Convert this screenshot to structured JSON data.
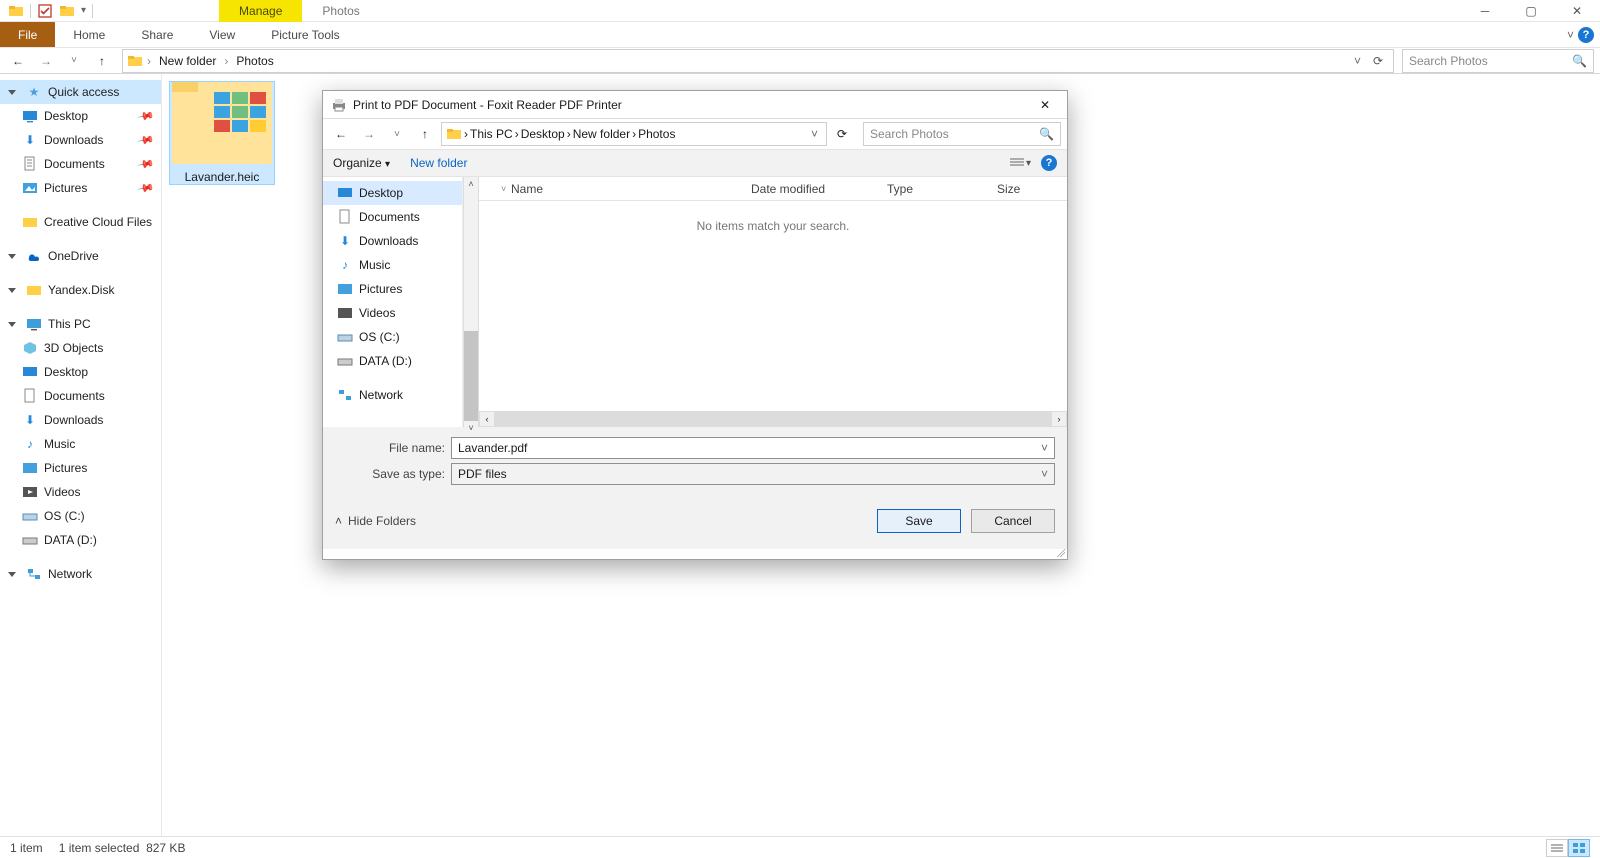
{
  "titlebar": {
    "tab_manage": "Manage",
    "tab_photos": "Photos"
  },
  "ribbon": {
    "file": "File",
    "home": "Home",
    "share": "Share",
    "view": "View",
    "picture_tools": "Picture Tools"
  },
  "nav": {
    "crumbs": [
      "New folder",
      "Photos"
    ],
    "search_placeholder": "Search Photos"
  },
  "sidebar": {
    "quick_access": "Quick access",
    "items_pinned": [
      {
        "label": "Desktop"
      },
      {
        "label": "Downloads"
      },
      {
        "label": "Documents"
      },
      {
        "label": "Pictures"
      }
    ],
    "creative_cloud": "Creative Cloud Files",
    "onedrive": "OneDrive",
    "yandex": "Yandex.Disk",
    "this_pc": "This PC",
    "this_pc_items": [
      {
        "label": "3D Objects"
      },
      {
        "label": "Desktop"
      },
      {
        "label": "Documents"
      },
      {
        "label": "Downloads"
      },
      {
        "label": "Music"
      },
      {
        "label": "Pictures"
      },
      {
        "label": "Videos"
      },
      {
        "label": "OS (C:)"
      },
      {
        "label": "DATA (D:)"
      }
    ],
    "network": "Network"
  },
  "file_tile": {
    "name": "Lavander.heic"
  },
  "status": {
    "count": "1 item",
    "selection": "1 item selected",
    "size": "827 KB"
  },
  "dialog": {
    "title": "Print to PDF Document - Foxit Reader PDF Printer",
    "crumbs": [
      "This PC",
      "Desktop",
      "New folder",
      "Photos"
    ],
    "search_placeholder": "Search Photos",
    "toolbar": {
      "organize": "Organize",
      "new_folder": "New folder"
    },
    "tree": [
      {
        "label": "Desktop"
      },
      {
        "label": "Documents"
      },
      {
        "label": "Downloads"
      },
      {
        "label": "Music"
      },
      {
        "label": "Pictures"
      },
      {
        "label": "Videos"
      },
      {
        "label": "OS (C:)"
      },
      {
        "label": "DATA (D:)"
      }
    ],
    "network": "Network",
    "columns": {
      "name": "Name",
      "date": "Date modified",
      "type": "Type",
      "size": "Size"
    },
    "empty": "No items match your search.",
    "file_name_label": "File name:",
    "file_name_value": "Lavander.pdf",
    "save_type_label": "Save as type:",
    "save_type_value": "PDF files",
    "hide_folders": "Hide Folders",
    "save": "Save",
    "cancel": "Cancel"
  }
}
